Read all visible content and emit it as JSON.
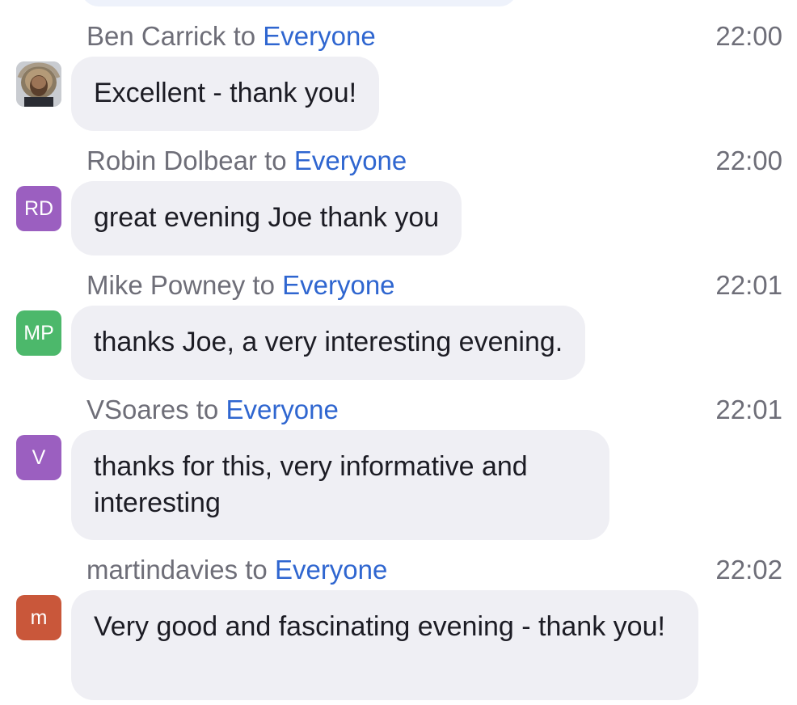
{
  "messages": [
    {
      "sender": "Ben Carrick",
      "to_word": "to",
      "recipient": "Everyone",
      "time": "22:00",
      "text": "Excellent - thank you!",
      "avatar": {
        "type": "photo",
        "initials": "",
        "color": "#bfc5cc"
      }
    },
    {
      "sender": "Robin Dolbear",
      "to_word": "to",
      "recipient": "Everyone",
      "time": "22:00",
      "text": "great evening Joe thank you",
      "avatar": {
        "type": "initials",
        "initials": "RD",
        "color": "#9b5fc0"
      }
    },
    {
      "sender": "Mike Powney",
      "to_word": "to",
      "recipient": "Everyone",
      "time": "22:01",
      "text": "thanks Joe, a very interesting evening.",
      "avatar": {
        "type": "initials",
        "initials": "MP",
        "color": "#4cb86b"
      }
    },
    {
      "sender": "VSoares",
      "to_word": "to",
      "recipient": "Everyone",
      "time": "22:01",
      "text": "thanks for this, very informative and interesting",
      "avatar": {
        "type": "initials",
        "initials": "V",
        "color": "#9b5fc0"
      }
    },
    {
      "sender": "martindavies",
      "to_word": "to",
      "recipient": "Everyone",
      "time": "22:02",
      "text": "Very good and fascinating evening - thank you!",
      "avatar": {
        "type": "initials",
        "initials": "m",
        "color": "#c9573a"
      }
    }
  ]
}
